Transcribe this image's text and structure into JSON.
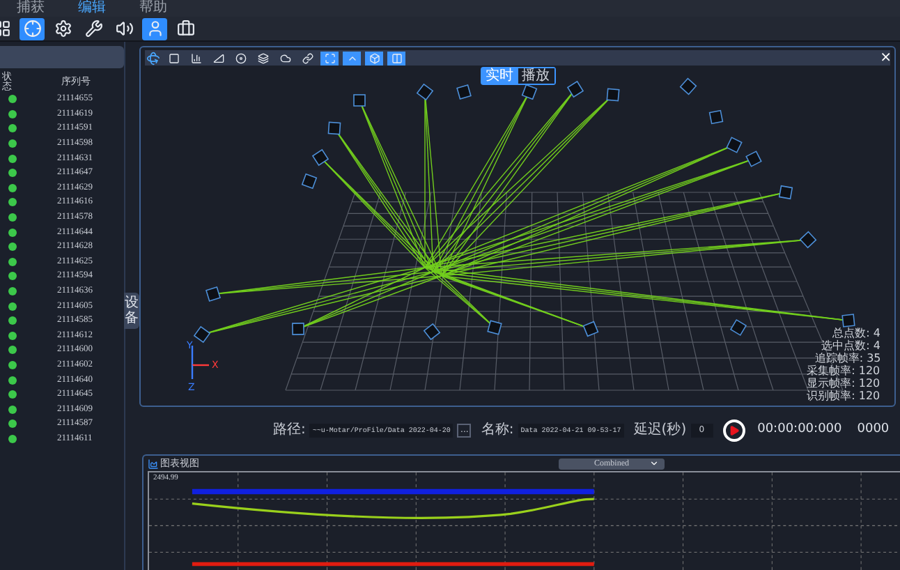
{
  "menu": [
    {
      "label": "捕获",
      "selected": false
    },
    {
      "label": "编辑",
      "selected": true
    },
    {
      "label": "帮助",
      "selected": false
    }
  ],
  "toolbar": [
    {
      "kind": "grid",
      "selected": false
    },
    {
      "kind": "target",
      "selected": true
    },
    {
      "kind": "gear",
      "selected": false
    },
    {
      "kind": "wrench",
      "selected": false
    },
    {
      "kind": "speaker",
      "selected": false
    },
    {
      "kind": "person",
      "selected": true
    },
    {
      "kind": "case",
      "selected": false
    }
  ],
  "device_list": {
    "columns": [
      "状态",
      "序列号"
    ],
    "rows": [
      {
        "color": "#3cc84a",
        "serial": "21114655"
      },
      {
        "color": "#3cc84a",
        "serial": "21114619"
      },
      {
        "color": "#3cc84a",
        "serial": "21114591"
      },
      {
        "color": "#3cc84a",
        "serial": "21114598"
      },
      {
        "color": "#3cc84a",
        "serial": "21114631"
      },
      {
        "color": "#3cc84a",
        "serial": "21114647"
      },
      {
        "color": "#3cc84a",
        "serial": "21114629"
      },
      {
        "color": "#3cc84a",
        "serial": "21114616"
      },
      {
        "color": "#3cc84a",
        "serial": "21114578"
      },
      {
        "color": "#3cc84a",
        "serial": "21114644"
      },
      {
        "color": "#3cc84a",
        "serial": "21114628"
      },
      {
        "color": "#3cc84a",
        "serial": "21114625"
      },
      {
        "color": "#3cc84a",
        "serial": "21114594"
      },
      {
        "color": "#3cc84a",
        "serial": "21114636"
      },
      {
        "color": "#3cc84a",
        "serial": "21114605"
      },
      {
        "color": "#3cc84a",
        "serial": "21114585"
      },
      {
        "color": "#3cc84a",
        "serial": "21114612"
      },
      {
        "color": "#3cc84a",
        "serial": "21114600"
      },
      {
        "color": "#3cc84a",
        "serial": "21114602"
      },
      {
        "color": "#3cc84a",
        "serial": "21114640"
      },
      {
        "color": "#3cc84a",
        "serial": "21114645"
      },
      {
        "color": "#3cc84a",
        "serial": "21114609"
      },
      {
        "color": "#3cc84a",
        "serial": "21114587"
      },
      {
        "color": "#3cc84a",
        "serial": "21114611"
      }
    ]
  },
  "side_tab": {
    "label": "设备"
  },
  "view3d": {
    "tools": [
      {
        "kind": "frame",
        "selected": false
      },
      {
        "kind": "bars",
        "selected": false
      },
      {
        "kind": "angle",
        "selected": false
      },
      {
        "kind": "disc",
        "selected": false
      },
      {
        "kind": "layers",
        "selected": false
      },
      {
        "kind": "cloud",
        "selected": false
      },
      {
        "kind": "link",
        "selected": false
      },
      {
        "kind": "fit",
        "selected": true
      },
      {
        "kind": "up",
        "selected": true
      },
      {
        "kind": "box",
        "selected": true
      },
      {
        "kind": "split",
        "selected": true
      }
    ],
    "close": "×",
    "modes": [
      {
        "label": "实时",
        "selected": true
      },
      {
        "label": "播放",
        "selected": false
      }
    ],
    "axes": [
      "Y",
      "X",
      "Z"
    ],
    "stats": [
      "总点数: 4",
      "选中点数: 4",
      "追踪帧率: 35",
      "采集帧率: 120",
      "显示帧率: 120",
      "识别帧率: 120"
    ]
  },
  "playback": {
    "path_label": "路径:",
    "path": "~~u-Motar/ProFile/Data 2022-04-20",
    "browse": "...",
    "name_label": "名称:",
    "name": "Data 2022-04-21 09-53-17",
    "delay_label": "延迟(秒)",
    "delay": "0",
    "time": "00:00:00:000",
    "frame": "0000"
  },
  "chart_panel": {
    "title": "图表视图",
    "mode": "Combined",
    "y_value": "2494.99"
  }
}
